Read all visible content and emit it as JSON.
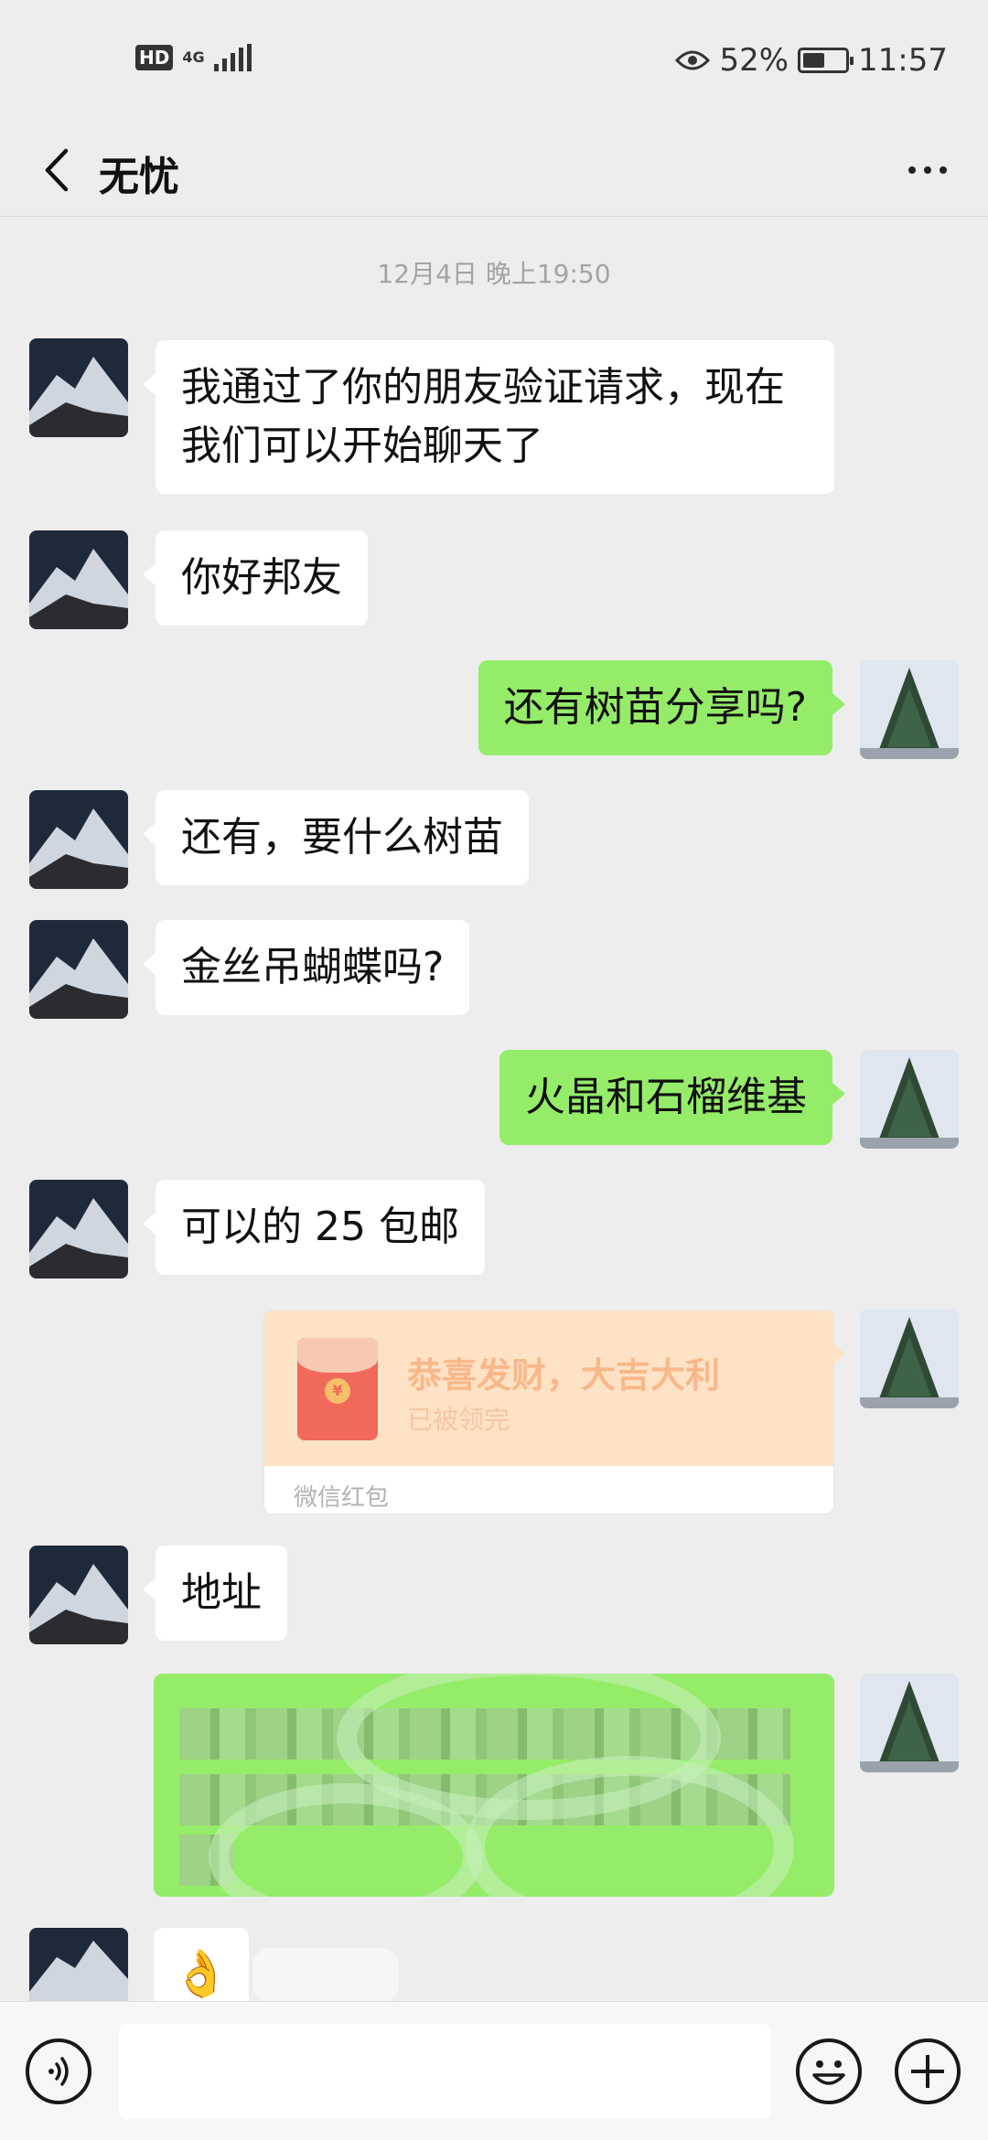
{
  "status_bar": {
    "hd": "HD",
    "network": "4G",
    "battery_percent": "52%",
    "battery_level": 0.52,
    "time": "11:57"
  },
  "header": {
    "title": "无忧",
    "back_icon": "chevron-left-icon",
    "more_icon": "more-dots-icon"
  },
  "chat": {
    "timestamp": "12月4日 晚上19:50",
    "messages": [
      {
        "side": "in",
        "text": "我通过了你的朋友验证请求，现在我们可以开始聊天了"
      },
      {
        "side": "in",
        "text": "你好邦友"
      },
      {
        "side": "out",
        "text": "还有树苗分享吗?"
      },
      {
        "side": "in",
        "text": "还有，要什么树苗"
      },
      {
        "side": "in",
        "text": "金丝吊蝴蝶吗?"
      },
      {
        "side": "out",
        "text": "火晶和石榴维基"
      },
      {
        "side": "in",
        "text": "可以的 25 包邮"
      },
      {
        "side": "out",
        "type": "red_packet",
        "title": "恭喜发财，大吉大利",
        "status": "已被领完",
        "footer": "微信红包"
      },
      {
        "side": "in",
        "text": "地址"
      },
      {
        "side": "out",
        "type": "redacted_address"
      },
      {
        "side": "in",
        "text": "👌"
      }
    ]
  },
  "input_bar": {
    "voice_icon": "voice-icon",
    "emoji_icon": "emoji-icon",
    "plus_icon": "plus-icon",
    "input_value": ""
  },
  "colors": {
    "background": "#ededed",
    "bubble_in": "#ffffff",
    "bubble_out": "#95ec69",
    "red_packet": "#fde2c5"
  }
}
